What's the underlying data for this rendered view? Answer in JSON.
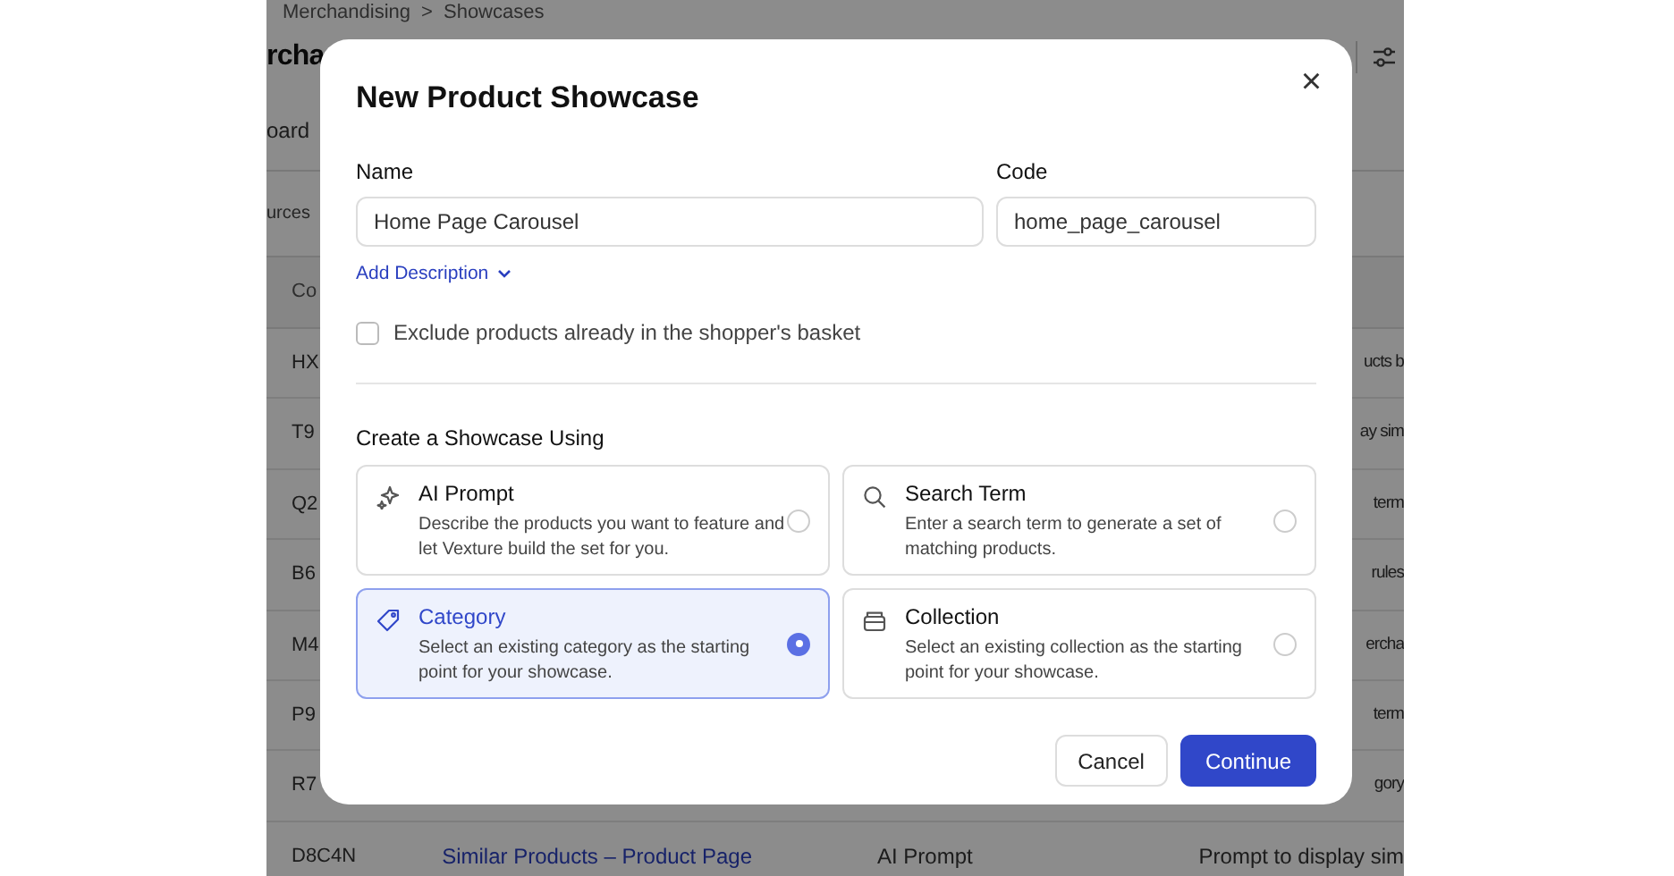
{
  "background": {
    "breadcrumb": [
      "Merchandising",
      "Showcases"
    ],
    "breadcrumb_separator": ">",
    "page_title": "rcha",
    "tab": "oard",
    "filter": "urces",
    "table": {
      "header": "Co",
      "rows": [
        {
          "code": "HX",
          "column_4": "ucts b"
        },
        {
          "code": "T9",
          "column_4": "ay sim"
        },
        {
          "code": "Q2",
          "column_4": "term"
        },
        {
          "code": "B6",
          "column_4": "rules"
        },
        {
          "code": "M4",
          "column_4": "ercha"
        },
        {
          "code": "P9",
          "column_4": "term"
        },
        {
          "code": "R7",
          "column_4": "gory"
        },
        {
          "code": "D8C4N",
          "name": "Similar Products – Product Page",
          "type": "AI Prompt",
          "column_4": "Prompt to display sim"
        }
      ]
    }
  },
  "dialog": {
    "title": "New Product Showcase",
    "close": "×",
    "name": {
      "label": "Name",
      "value": "Home Page Carousel"
    },
    "code": {
      "label": "Code",
      "value": "home_page_carousel"
    },
    "add_description": "Add Description",
    "exclude_basket": {
      "label": "Exclude products already in the shopper's basket",
      "checked": false
    },
    "section_title": "Create a Showcase Using",
    "options": [
      {
        "kind": "ai",
        "title": "AI Prompt",
        "description": "Describe the products you want to feature and let Vexture build the set for you.",
        "selected": false
      },
      {
        "kind": "search",
        "title": "Search Term",
        "description": "Enter a search term to generate a set of matching products.",
        "selected": false
      },
      {
        "kind": "category",
        "title": "Category",
        "description": "Select an existing category as the starting point for your showcase.",
        "selected": true
      },
      {
        "kind": "collection",
        "title": "Collection",
        "description": "Select an existing collection as the starting point for your showcase.",
        "selected": false
      }
    ],
    "buttons": [
      {
        "kind": "secondary",
        "label": "Cancel"
      },
      {
        "kind": "primary",
        "label": "Continue"
      }
    ]
  }
}
